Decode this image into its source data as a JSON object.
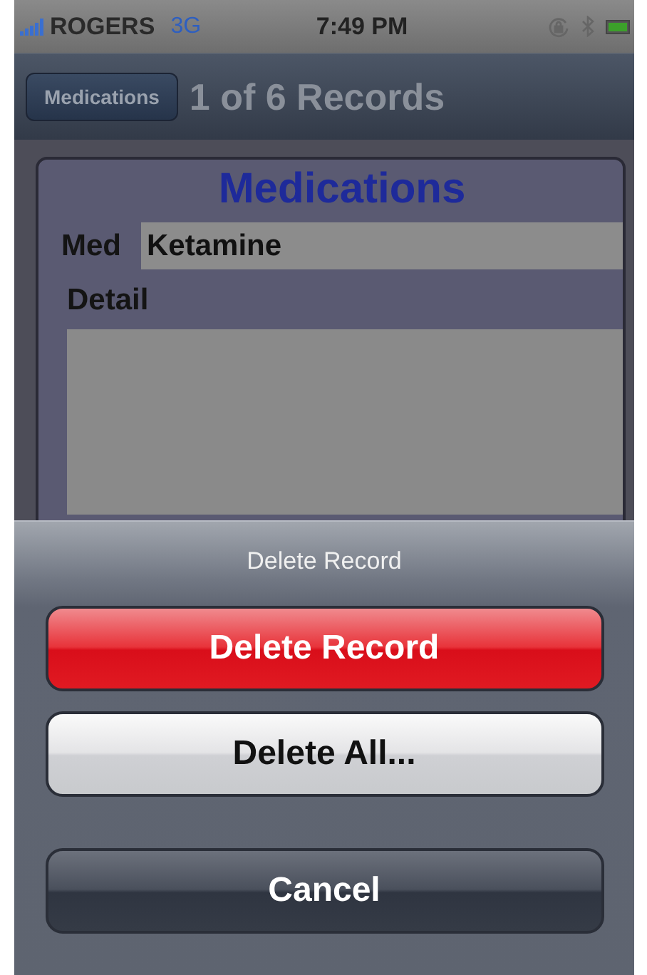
{
  "status_bar": {
    "carrier": "ROGERS",
    "network": "3G",
    "time": "7:49 PM"
  },
  "nav_bar": {
    "back_button": "Medications",
    "title": "1 of 6 Records"
  },
  "form": {
    "title": "Medications",
    "fields": [
      {
        "kind": "text",
        "label": "Med",
        "value": "Ketamine"
      },
      {
        "kind": "textarea",
        "label": "Detail"
      }
    ]
  },
  "action_sheet": {
    "title": "Delete Record",
    "buttons": [
      {
        "kind": "destructive",
        "label": "Delete Record"
      },
      {
        "kind": "default",
        "label": "Delete All..."
      },
      {
        "kind": "cancel",
        "label": "Cancel"
      }
    ]
  }
}
